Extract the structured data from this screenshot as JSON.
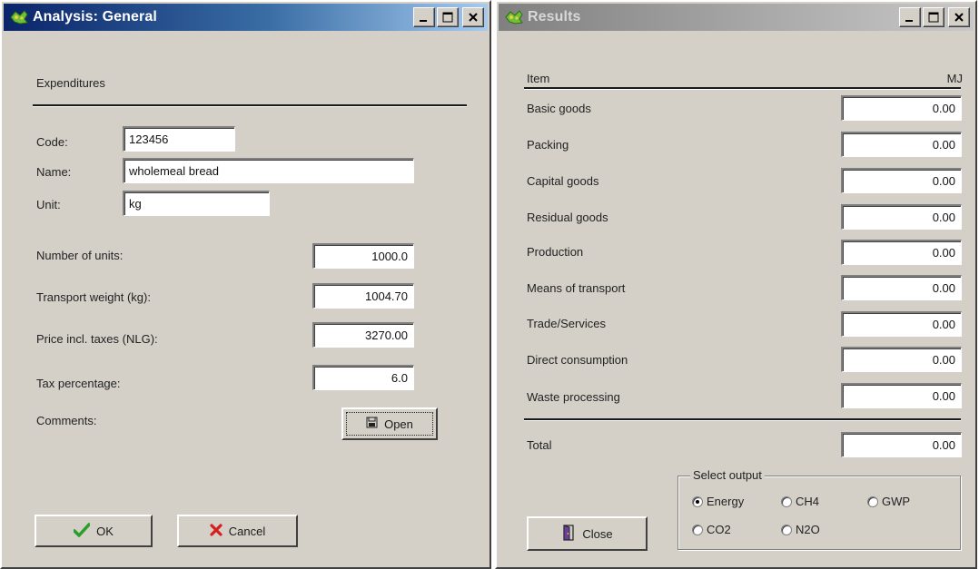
{
  "analysis_window": {
    "title": "Analysis: General",
    "section_label": "Expenditures",
    "code_label": "Code:",
    "code_value": "123456",
    "name_label": "Name:",
    "name_value": "wholemeal bread",
    "unit_label": "Unit:",
    "unit_value": "kg",
    "number_units_label": "Number of units:",
    "number_units_value": "1000.0",
    "transport_weight_label": "Transport weight (kg):",
    "transport_weight_value": "1004.70",
    "price_label": "Price incl. taxes (NLG):",
    "price_value": "3270.00",
    "tax_label": "Tax percentage:",
    "tax_value": "6.0",
    "comments_label": "Comments:",
    "open_label": "Open",
    "ok_label": "OK",
    "cancel_label": "Cancel"
  },
  "results_window": {
    "title": "Results",
    "col_item": "Item",
    "col_unit": "MJ",
    "rows": [
      {
        "label": "Basic goods",
        "value": "0.00"
      },
      {
        "label": "Packing",
        "value": "0.00"
      },
      {
        "label": "Capital goods",
        "value": "0.00"
      },
      {
        "label": "Residual goods",
        "value": "0.00"
      },
      {
        "label": "Production",
        "value": "0.00"
      },
      {
        "label": "Means of transport",
        "value": "0.00"
      },
      {
        "label": "Trade/Services",
        "value": "0.00"
      },
      {
        "label": "Direct consumption",
        "value": "0.00"
      },
      {
        "label": "Waste processing",
        "value": "0.00"
      }
    ],
    "total_label": "Total",
    "total_value": "0.00",
    "select_output_label": "Select output",
    "output_options": [
      {
        "label": "Energy",
        "checked": true
      },
      {
        "label": "CH4",
        "checked": false
      },
      {
        "label": "GWP",
        "checked": false
      },
      {
        "label": "CO2",
        "checked": false
      },
      {
        "label": "N2O",
        "checked": false
      }
    ],
    "close_label": "Close"
  },
  "colors": {
    "window_bg": "#d4d0c8",
    "active_title": "#0a246a",
    "inactive_title": "#808080",
    "ok_check": "#2a9d2a",
    "cancel_x": "#d41f1f"
  },
  "icons": {
    "app": "app-logo-icon",
    "minimize": "minimize-icon",
    "maximize": "maximize-icon",
    "close": "close-icon",
    "open": "disk-icon",
    "ok": "checkmark-icon",
    "cancel": "x-mark-icon",
    "close_button": "door-icon"
  }
}
